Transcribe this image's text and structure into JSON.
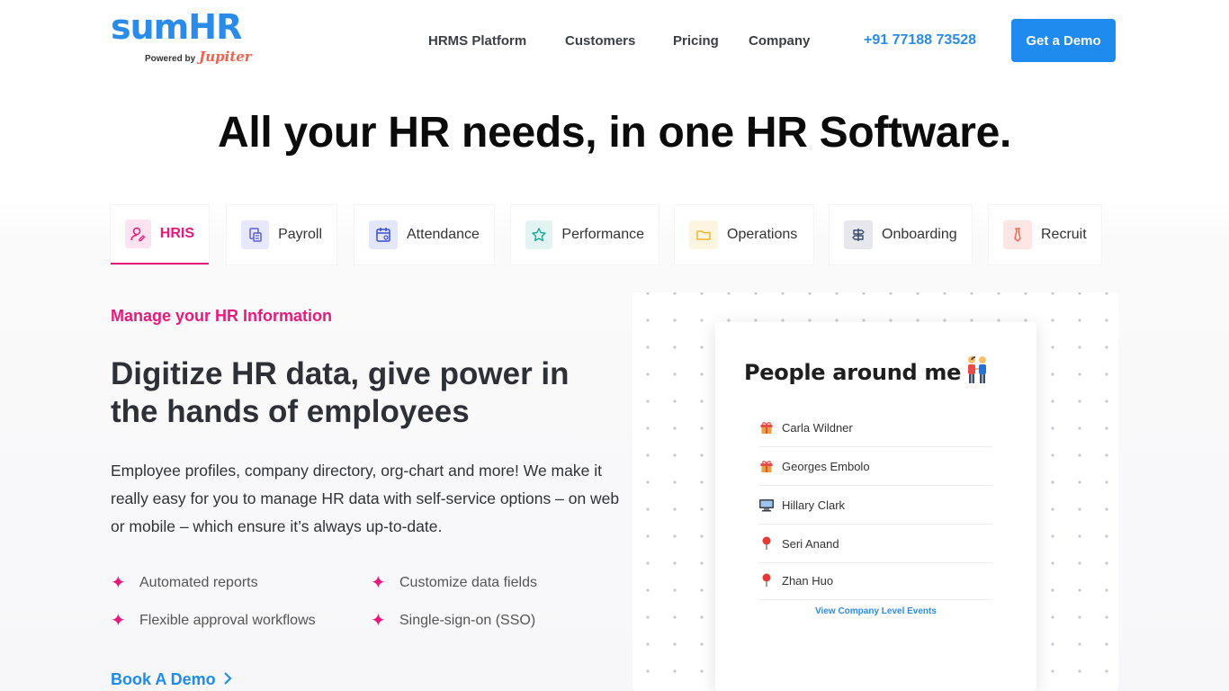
{
  "header": {
    "logo": {
      "brand": "sumHR",
      "powered_by": "Powered by",
      "partner": "Jupiter"
    },
    "nav": [
      "HRMS Platform",
      "Customers",
      "Pricing",
      "Company"
    ],
    "phone": "+91 77188 73528",
    "cta_label": "Get a Demo"
  },
  "hero": {
    "title": "All your HR needs, in one HR Software."
  },
  "tabs": [
    {
      "label": "HRIS",
      "icon": "user-edit-icon",
      "active": true,
      "color": "#e8197d"
    },
    {
      "label": "Payroll",
      "icon": "payroll-icon",
      "color": "#5b5fd6"
    },
    {
      "label": "Attendance",
      "icon": "calendar-icon",
      "color": "#3b4fd0"
    },
    {
      "label": "Performance",
      "icon": "star-icon",
      "color": "#18a89a"
    },
    {
      "label": "Operations",
      "icon": "folder-icon",
      "color": "#f2b531"
    },
    {
      "label": "Onboarding",
      "icon": "signpost-icon",
      "color": "#3a4a6b"
    },
    {
      "label": "Recruit",
      "icon": "tie-icon",
      "color": "#f0624d"
    }
  ],
  "content": {
    "eyebrow": "Manage your HR Information",
    "heading": "Digitize HR data, give power in the hands of employees",
    "paragraph": "Employee profiles, company directory, org-chart and more! We make it really easy for you to manage HR data with self-service options – on web or mobile – which ensure it’s always up-to-date.",
    "features": [
      "Automated reports",
      "Customize data fields",
      "Flexible approval workflows",
      "Single-sign-on (SSO)"
    ],
    "book_demo": "Book A Demo"
  },
  "card": {
    "title": "People around me",
    "title_icon": "people-holding-hands-icon",
    "people": [
      {
        "name": "Carla Wildner",
        "icon": "gift-icon"
      },
      {
        "name": "Georges Embolo",
        "icon": "gift-icon"
      },
      {
        "name": "Hillary Clark",
        "icon": "computer-icon"
      },
      {
        "name": "Seri Anand",
        "icon": "pin-icon"
      },
      {
        "name": "Zhan Huo",
        "icon": "pin-icon"
      }
    ],
    "link": "View Company Level Events"
  },
  "colors": {
    "accent": "#e8197d",
    "primary": "#1f8bef"
  }
}
